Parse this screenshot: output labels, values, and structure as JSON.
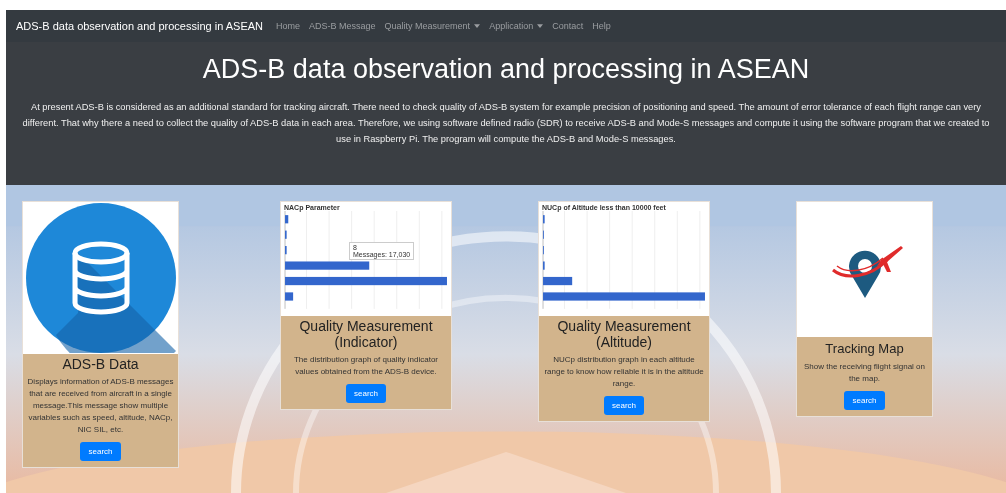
{
  "navbar": {
    "brand": "ADS-B data observation and processing in ASEAN",
    "links": [
      {
        "label": "Home",
        "dropdown": false
      },
      {
        "label": "ADS-B Message",
        "dropdown": false
      },
      {
        "label": "Quality Measurement",
        "dropdown": true
      },
      {
        "label": "Application",
        "dropdown": true
      },
      {
        "label": "Contact",
        "dropdown": false
      },
      {
        "label": "Help",
        "dropdown": false
      }
    ]
  },
  "hero": {
    "title": "ADS-B data observation and processing in ASEAN",
    "text": "At present ADS-B is considered as an additional standard for tracking aircraft. There need to check quality of ADS-B system for example precision of positioning and speed. The amount of error tolerance of each flight range can very different. That why there a need to collect the quality of ADS-B data in each area. Therefore, we using software defined radio (SDR) to receive ADS-B and Mode-S messages and compute it using the software program that we created to use in Raspberry Pi. The program will compute the ADS-B and Mode-S messages."
  },
  "cards": [
    {
      "kind": "database",
      "title": "ADS-B Data",
      "text": "Displays information of ADS-B messages that are received from aircraft in a single message.This message show multiple variables such as speed, altitude, NACp, NIC SIL, etc.",
      "button": "search"
    },
    {
      "kind": "chart-indicator",
      "chart_title": "NACp Parameter",
      "tooltip": [
        "8",
        "Messages: 17,030"
      ],
      "title": "Quality Measurement (Indicator)",
      "text": "The distribution graph of quality indicator values obtained from the ADS-B device.",
      "button": "search"
    },
    {
      "kind": "chart-altitude",
      "chart_title": "NUCp of Altitude less than 10000 feet",
      "title": "Quality Measurement (Altitude)",
      "text": "NUCp distribution graph in each altitude range to know how reliable it is in the altitude range.",
      "button": "search"
    },
    {
      "kind": "map-pin",
      "title": "Tracking Map",
      "text": "Show the receiving flight signal on the map.",
      "button": "search"
    }
  ]
}
